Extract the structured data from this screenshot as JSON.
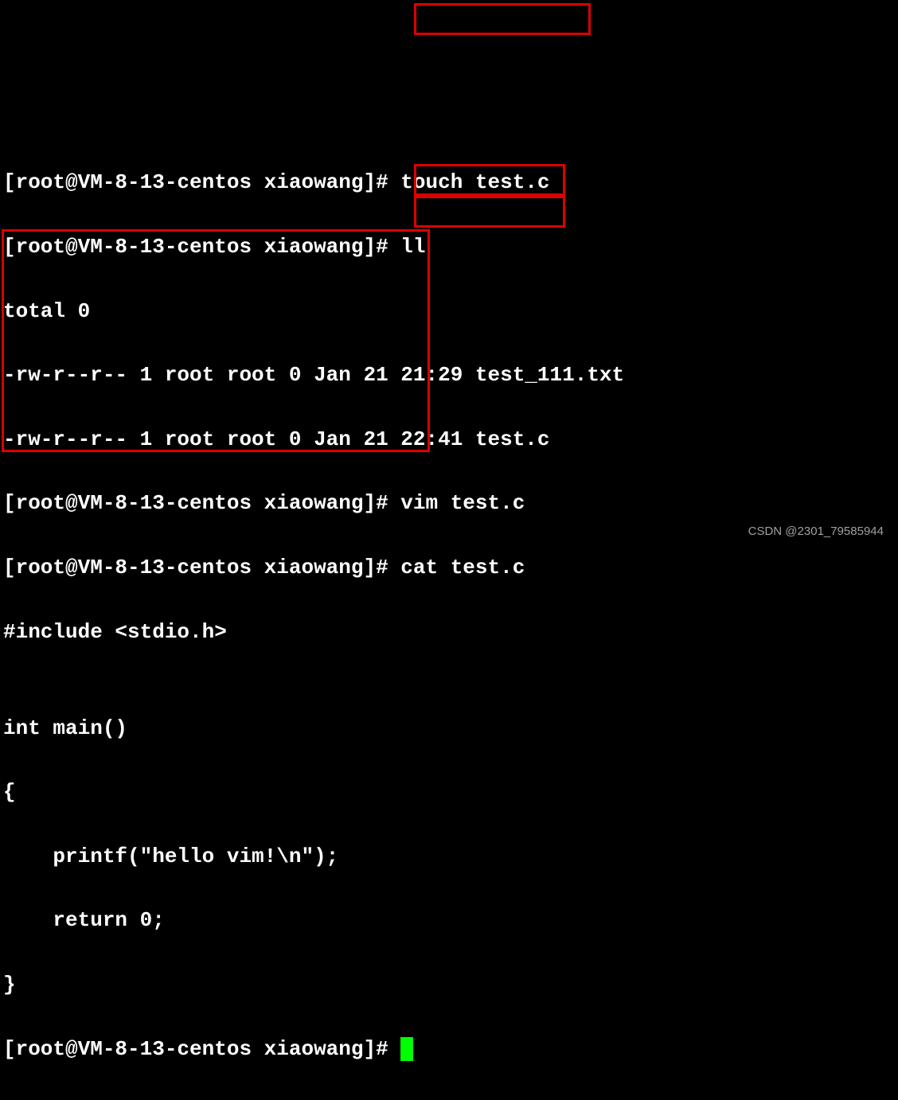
{
  "terminal": {
    "prompt": "[root@VM-8-13-centos xiaowang]#",
    "lines": {
      "cmd_touch": "touch test.c",
      "cmd_ll": "ll",
      "total": "total 0",
      "file1": "-rw-r--r-- 1 root root 0 Jan 21 21:29 test_111.txt",
      "file2": "-rw-r--r-- 1 root root 0 Jan 21 22:41 test.c",
      "cmd_vim": "vim test.c",
      "cmd_cat": "cat test.c",
      "code_include": "#include <stdio.h>",
      "code_blank": "",
      "code_main": "int main()",
      "code_open": "{",
      "code_printf": "    printf(\"hello vim!\\n\");",
      "code_return": "    return 0;",
      "code_close": "}"
    }
  },
  "watermark": "CSDN @2301_79585944"
}
